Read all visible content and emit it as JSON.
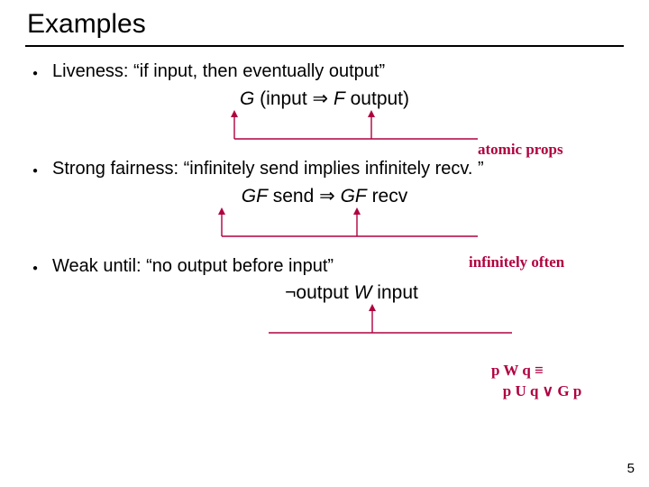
{
  "title": "Examples",
  "bullets": [
    {
      "label": "Liveness:  “if input, then eventually output”",
      "formula_html": "<span class='op'>G</span> (input ⇒ <span class='op'>F</span> output)",
      "annotation": "atomic props"
    },
    {
      "label": "Strong fairness: “infinitely send implies infinitely recv. ”",
      "formula_html": "<span class='op'>GF</span> send  ⇒  <span class='op'>GF</span> recv",
      "annotation": "infinitely often"
    },
    {
      "label": "Weak until: “no output before input”",
      "formula_html": "¬output <span class='op'>W</span> input",
      "annotation_html": "p W q ≡<br>&nbsp;&nbsp;&nbsp;p U q ∨ G p"
    }
  ],
  "page_number": "5"
}
